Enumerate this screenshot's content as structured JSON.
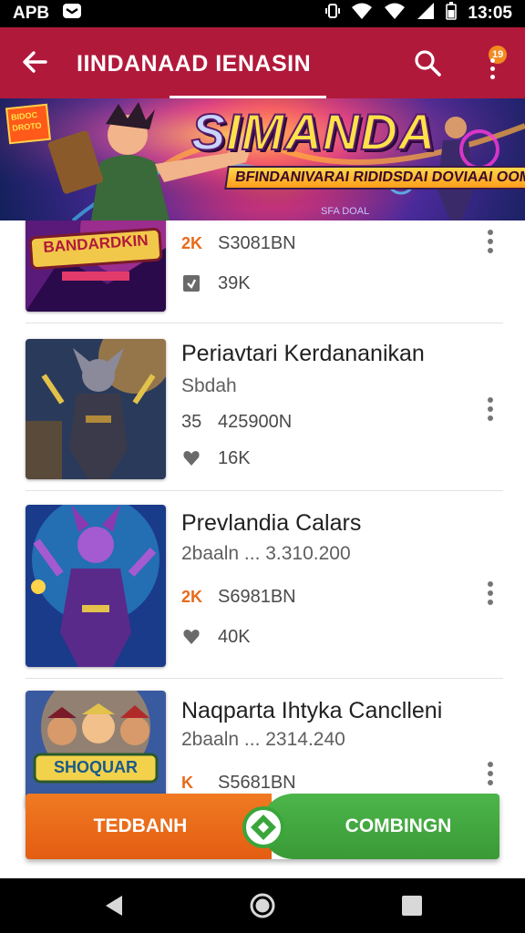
{
  "status_bar": {
    "carrier": "APB",
    "time": "13:05",
    "icons": [
      "mail-icon",
      "vibrate-icon",
      "wifi-icon",
      "wifi-alt-icon",
      "signal-icon",
      "battery-icon"
    ]
  },
  "app_bar": {
    "title": "IINDANAAD IENASIN",
    "badge": "19",
    "icons": [
      "back-arrow-icon",
      "search-icon",
      "more-vert-icon"
    ],
    "colors": {
      "bar": "#b1193b",
      "badge": "#f28a20"
    }
  },
  "banner": {
    "title": "IMANDA",
    "title_prefix": "S",
    "subtitle": "BFINDANIVARAI RIDIDSDAI DOVIAAI OOMION",
    "small_text": "SFA DOAL",
    "corner_badge": "BIDOC DROTO",
    "colors": {
      "title": "#ffe14a",
      "accent": "#ff7a1a"
    }
  },
  "list": {
    "items": [
      {
        "thumb_text": "BANDARDKIN",
        "title": "",
        "subtitle": "",
        "rank": "2K",
        "code": "S3081BN",
        "stat": "39K",
        "stat_icon": "box-icon"
      },
      {
        "title": "Periavtari Kerdananikan",
        "subtitle": "Sbdah",
        "rank": "35",
        "code": "425900N",
        "stat": "16K",
        "stat_icon": "heart-icon"
      },
      {
        "title": "Prevlandia Calars",
        "subtitle": "2baaln ... 3.310.200",
        "rank": "2K",
        "code": "S6981BN",
        "stat": "40K",
        "stat_icon": "heart-icon"
      },
      {
        "thumb_text": "SHOQUAR",
        "title": "Naqparta Ihtyka Canclleni",
        "subtitle": "2baaln ... 2314.240",
        "rank": "K",
        "code": "S5681BN",
        "stat": "",
        "stat_icon": "rank-icon"
      }
    ]
  },
  "action_bar": {
    "left_label": "TEDBANH",
    "right_label": "COMBINGN",
    "colors": {
      "left": "#f07a22",
      "right": "#4cb54a"
    }
  },
  "nav_bar": {
    "icons": [
      "back-triangle-icon",
      "home-circle-icon",
      "recents-square-icon"
    ]
  }
}
